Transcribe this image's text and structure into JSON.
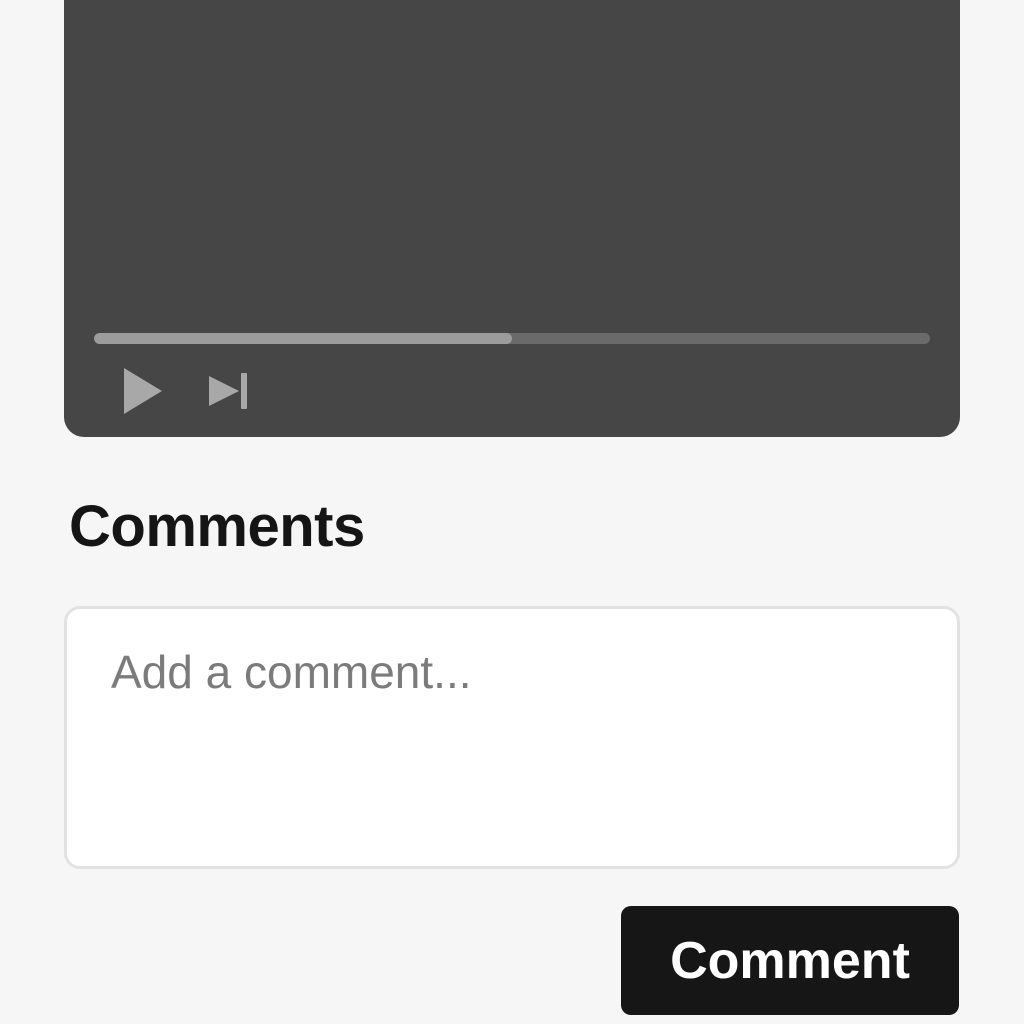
{
  "video": {
    "progress_fraction": 0.5,
    "controls": {
      "play_icon": "play-icon",
      "next_icon": "skip-next-icon"
    },
    "colors": {
      "background": "#464646",
      "track": "#6a6a6a",
      "fill": "#9c9c9c",
      "control_icon": "#a8a8a8"
    }
  },
  "comments": {
    "heading": "Comments",
    "input_placeholder": "Add a comment...",
    "input_value": "",
    "submit_label": "Comment"
  },
  "colors": {
    "page_background": "#f6f6f6",
    "button_background": "#161616",
    "button_text": "#ffffff"
  }
}
